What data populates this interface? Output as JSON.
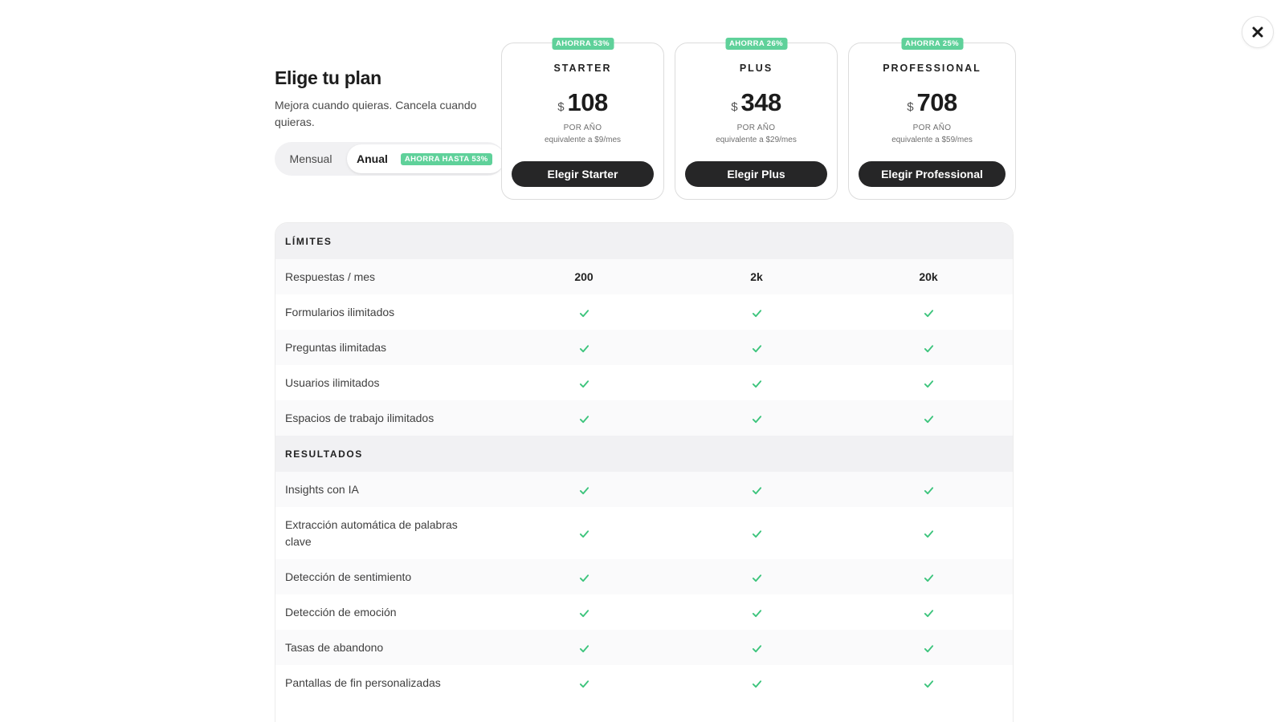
{
  "header": {
    "title": "Elige tu plan",
    "subtitle": "Mejora cuando quieras. Cancela cuando quieras."
  },
  "billing": {
    "monthly_label": "Mensual",
    "annual_label": "Anual",
    "annual_badge": "AHORRA HASTA 53%",
    "selected": "Anual"
  },
  "plans": [
    {
      "badge": "AHORRA 53%",
      "name": "STARTER",
      "currency": "$",
      "price": "108",
      "period": "POR AÑO",
      "equivalent": "equivalente a $9/mes",
      "button": "Elegir Starter"
    },
    {
      "badge": "AHORRA 26%",
      "name": "PLUS",
      "currency": "$",
      "price": "348",
      "period": "POR AÑO",
      "equivalent": "equivalente a $29/mes",
      "button": "Elegir Plus"
    },
    {
      "badge": "AHORRA 25%",
      "name": "PROFESSIONAL",
      "currency": "$",
      "price": "708",
      "period": "POR AÑO",
      "equivalent": "equivalente a $59/mes",
      "button": "Elegir Professional"
    }
  ],
  "table": {
    "sections": [
      {
        "title": "LÍMITES",
        "rows": [
          {
            "label": "Respuestas / mes",
            "values": [
              "200",
              "2k",
              "20k"
            ]
          },
          {
            "label": "Formularios ilimitados",
            "values": [
              "check",
              "check",
              "check"
            ]
          },
          {
            "label": "Preguntas ilimitadas",
            "values": [
              "check",
              "check",
              "check"
            ]
          },
          {
            "label": "Usuarios ilimitados",
            "values": [
              "check",
              "check",
              "check"
            ]
          },
          {
            "label": "Espacios de trabajo ilimitados",
            "values": [
              "check",
              "check",
              "check"
            ]
          }
        ]
      },
      {
        "title": "RESULTADOS",
        "rows": [
          {
            "label": "Insights con IA",
            "values": [
              "check",
              "check",
              "check"
            ]
          },
          {
            "label": "Extracción automática de palabras clave",
            "values": [
              "check",
              "check",
              "check"
            ]
          },
          {
            "label": "Detección de sentimiento",
            "values": [
              "check",
              "check",
              "check"
            ]
          },
          {
            "label": "Detección de emoción",
            "values": [
              "check",
              "check",
              "check"
            ]
          },
          {
            "label": "Tasas de abandono",
            "values": [
              "check",
              "check",
              "check"
            ]
          },
          {
            "label": "Pantallas de fin personalizadas",
            "values": [
              "check",
              "check",
              "check"
            ]
          }
        ]
      }
    ]
  },
  "colors": {
    "accent_green": "#5fd19a",
    "check_green": "#3cc47c",
    "button_dark": "#262627"
  },
  "icons": {
    "close": "close-icon",
    "check": "check-icon"
  }
}
